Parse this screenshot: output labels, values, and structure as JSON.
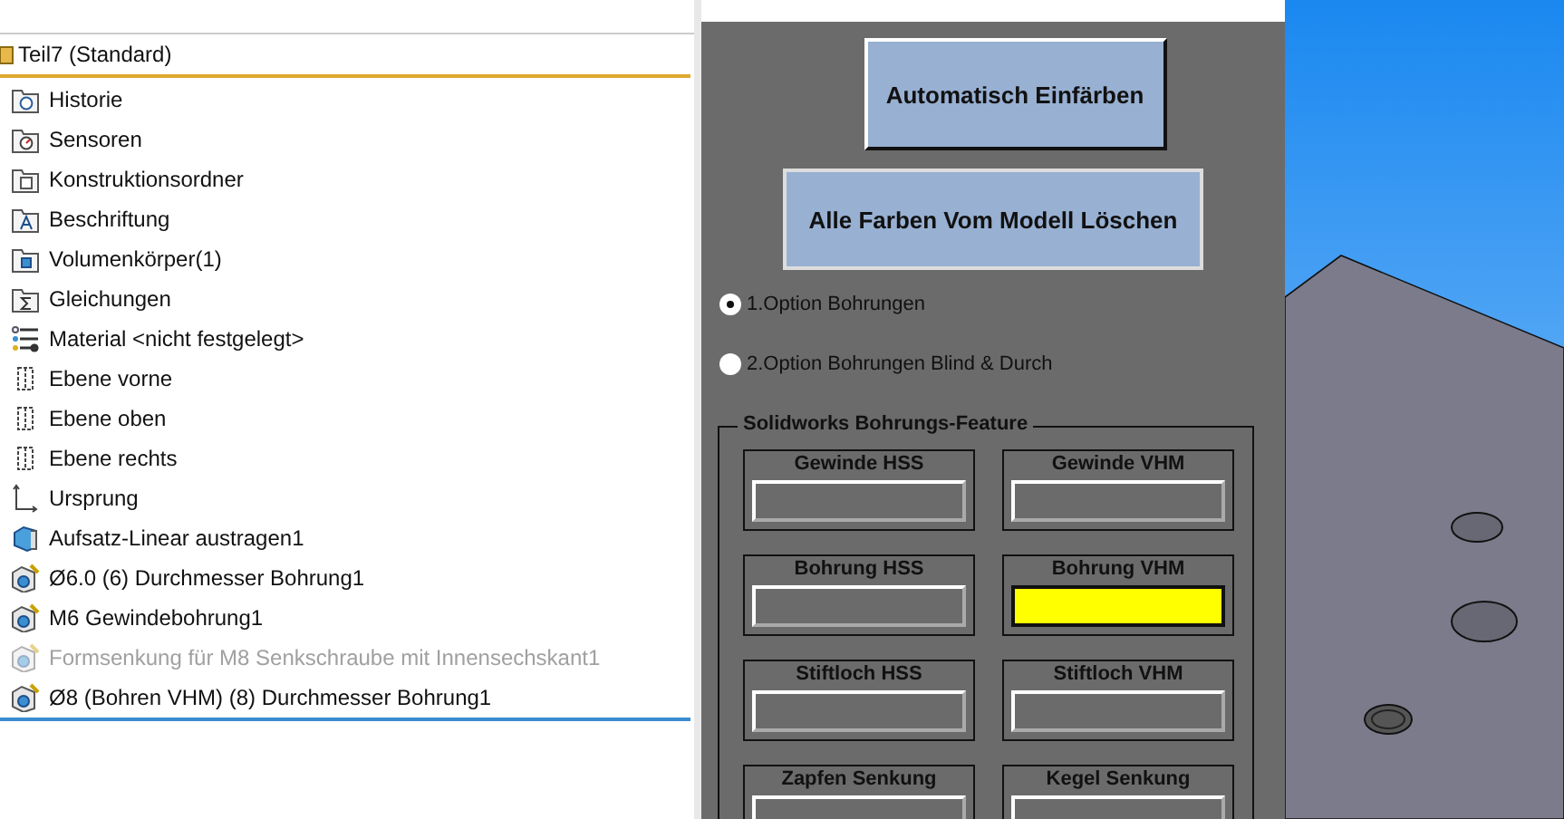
{
  "tree": {
    "root": {
      "label": "Teil7  (Standard)"
    },
    "items": [
      {
        "label": "Historie",
        "kind": "history",
        "disabled": false
      },
      {
        "label": "Sensoren",
        "kind": "sensor",
        "disabled": false
      },
      {
        "label": "Konstruktionsordner",
        "kind": "folder",
        "disabled": false
      },
      {
        "label": "Beschriftung",
        "kind": "annotation",
        "disabled": false
      },
      {
        "label": "Volumenkörper(1)",
        "kind": "bodies",
        "disabled": false
      },
      {
        "label": "Gleichungen",
        "kind": "equations",
        "disabled": false
      },
      {
        "label": "Material <nicht festgelegt>",
        "kind": "material",
        "disabled": false
      },
      {
        "label": "Ebene vorne",
        "kind": "plane",
        "disabled": false
      },
      {
        "label": "Ebene oben",
        "kind": "plane",
        "disabled": false
      },
      {
        "label": "Ebene rechts",
        "kind": "plane",
        "disabled": false
      },
      {
        "label": "Ursprung",
        "kind": "origin",
        "disabled": false
      },
      {
        "label": "Aufsatz-Linear austragen1",
        "kind": "extrude",
        "disabled": false
      },
      {
        "label": "Ø6.0 (6) Durchmesser Bohrung1",
        "kind": "hole",
        "disabled": false
      },
      {
        "label": "M6 Gewindebohrung1",
        "kind": "hole",
        "disabled": false
      },
      {
        "label": "Formsenkung für M8 Senkschraube mit Innensechskant1",
        "kind": "hole",
        "disabled": true
      },
      {
        "label": "Ø8 (Bohren VHM) (8) Durchmesser Bohrung1",
        "kind": "hole",
        "disabled": false
      }
    ]
  },
  "dialog": {
    "buttons": [
      "Automatisch Einfärben",
      "Alle Farben Vom Modell Löschen"
    ],
    "options": [
      {
        "label": "1.Option Bohrungen",
        "selected": true
      },
      {
        "label": "2.Option Bohrungen Blind & Durch",
        "selected": false
      }
    ],
    "group": {
      "title": "Solidworks Bohrungs-Feature",
      "slots": [
        {
          "label": "Gewinde HSS"
        },
        {
          "label": "Gewinde VHM"
        },
        {
          "label": "Bohrung HSS"
        },
        {
          "label": "Bohrung VHM",
          "color": "#ffff00"
        },
        {
          "label": "Stiftloch HSS"
        },
        {
          "label": "Stiftloch VHM"
        },
        {
          "label": "Zapfen Senkung"
        },
        {
          "label": "Kegel Senkung"
        }
      ]
    }
  }
}
